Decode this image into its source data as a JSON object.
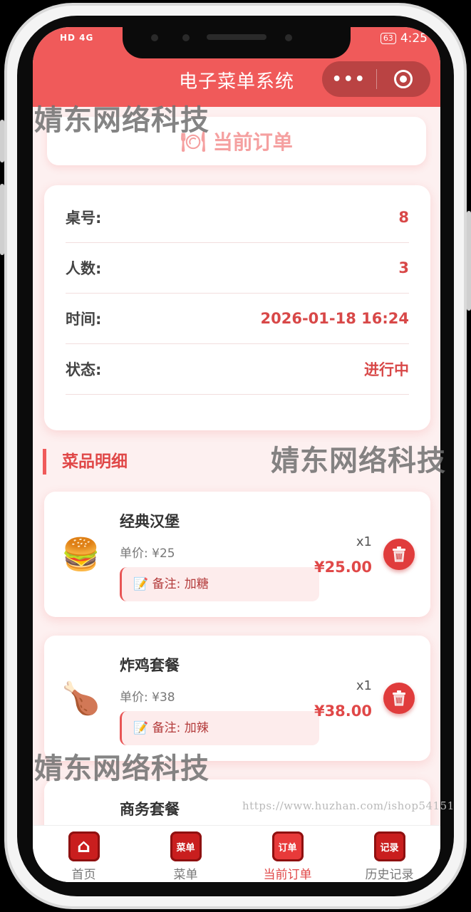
{
  "status_bar": {
    "network": "HD 4G",
    "battery": "63",
    "time": "4:25"
  },
  "nav": {
    "title": "电子菜单系统",
    "more_icon": "•••"
  },
  "order_header": {
    "icon": "🍽",
    "title": "当前订单"
  },
  "order_info": [
    {
      "label": "桌号:",
      "value": "8"
    },
    {
      "label": "人数:",
      "value": "3"
    },
    {
      "label": "时间:",
      "value": "2026-01-18 16:24"
    },
    {
      "label": "状态:",
      "value": "进行中"
    }
  ],
  "section": {
    "title": "菜品明细"
  },
  "dishes": [
    {
      "emoji": "🍔",
      "name": "经典汉堡",
      "unit_price": "单价: ¥25",
      "note": "📝 备注: 加糖",
      "qty": "x1",
      "subtotal": "¥25.00"
    },
    {
      "emoji": "🍗",
      "name": "炸鸡套餐",
      "unit_price": "单价: ¥38",
      "note": "📝 备注: 加辣",
      "qty": "x1",
      "subtotal": "¥38.00"
    },
    {
      "emoji": "",
      "name": "商务套餐",
      "unit_price": "",
      "note": "",
      "qty": "",
      "subtotal": ""
    }
  ],
  "watermarks": {
    "text": "婧东网络科技",
    "url": "https://www.huzhan.com/ishop54151"
  },
  "tabs": [
    {
      "label": "首页",
      "icon_text": "⌂",
      "active": false
    },
    {
      "label": "菜单",
      "icon_text": "菜单",
      "active": false
    },
    {
      "label": "当前订单",
      "icon_text": "订单",
      "active": true
    },
    {
      "label": "历史记录",
      "icon_text": "记录",
      "active": false
    }
  ],
  "colors": {
    "primary": "#f05a5a",
    "accent_text": "#e04848",
    "background": "#fdf0f0"
  }
}
